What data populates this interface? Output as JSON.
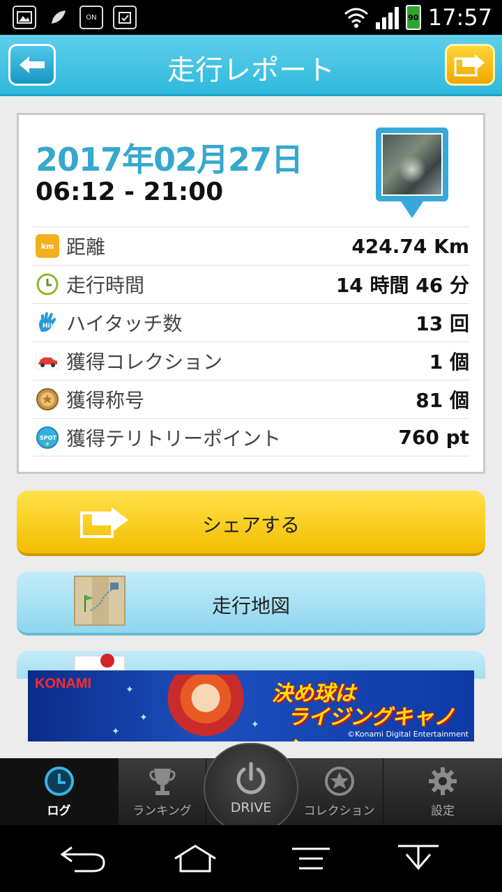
{
  "status_bar": {
    "time": "17:57",
    "battery": "90",
    "icons": [
      "image-icon",
      "leaf-icon",
      "voice-on-icon",
      "clipboard-icon"
    ],
    "voice_label": "ON"
  },
  "header": {
    "title": "走行レポート",
    "back_icon": "arrow-left-icon",
    "share_icon": "share-icon"
  },
  "report": {
    "date": "2017年02月27日",
    "time_range": "06:12 - 21:00",
    "rows": [
      {
        "icon": "km-icon",
        "icon_text": "km",
        "label": "距離",
        "value": "424.74 Km"
      },
      {
        "icon": "clock-icon",
        "icon_text": "",
        "label": "走行時間",
        "value": "14 時間 46 分"
      },
      {
        "icon": "hand-icon",
        "icon_text": "Hi",
        "label": "ハイタッチ数",
        "value": "13 回"
      },
      {
        "icon": "car-icon",
        "icon_text": "",
        "label": "獲得コレクション",
        "value": "1 個"
      },
      {
        "icon": "medal-icon",
        "icon_text": "",
        "label": "獲得称号",
        "value": "81 個"
      },
      {
        "icon": "spot-icon",
        "icon_text": "SPOT",
        "label": "獲得テリトリーポイント",
        "value": "760 pt"
      }
    ]
  },
  "actions": {
    "share_label": "シェアする",
    "map_label": "走行地図"
  },
  "banner": {
    "brand": "KONAMI",
    "catch_line1": "決め球は",
    "catch_line2": "ライジングキャノン",
    "copyright": "©Konami Digital Entertainment"
  },
  "tabs": [
    {
      "label": "ログ",
      "icon": "clock-icon",
      "active": true
    },
    {
      "label": "ランキング",
      "icon": "trophy-icon",
      "active": false
    },
    {
      "label": "DRIVE",
      "icon": "power-icon",
      "active": false
    },
    {
      "label": "コレクション",
      "icon": "star-icon",
      "active": false
    },
    {
      "label": "設定",
      "icon": "gear-icon",
      "active": false
    }
  ],
  "colors": {
    "header": "#2eb8dd",
    "date": "#36a8cc",
    "share_button": "#f3bd00",
    "map_button": "#8ed6ef"
  }
}
